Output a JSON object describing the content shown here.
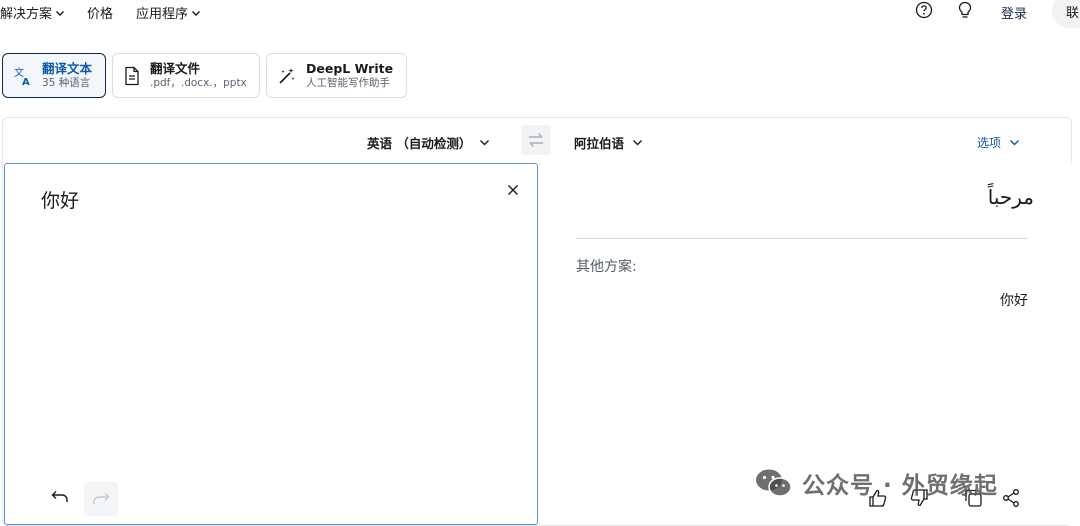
{
  "nav": {
    "solutions": "解决方案",
    "pricing": "价格",
    "apps": "应用程序",
    "login": "登录",
    "contact": "联"
  },
  "icons": {
    "help": "help-circle-icon",
    "tips": "lightbulb-icon"
  },
  "tabs": [
    {
      "title": "翻译文本",
      "subtitle": "35 种语言",
      "icon": "translate-icon",
      "active": true
    },
    {
      "title": "翻译文件",
      "subtitle": ".pdf，.docx.，pptx",
      "icon": "document-icon",
      "active": false
    },
    {
      "title": "DeepL Write",
      "subtitle": "人工智能写作助手",
      "icon": "magic-wand-icon",
      "active": false
    }
  ],
  "translator": {
    "source_lang": "英语 （自动检测）",
    "target_lang": "阿拉伯语",
    "options_label": "选项",
    "source_text": "你好",
    "target_text": "مرحباً",
    "alternatives_label": "其他方案:",
    "alternatives": [
      "你好"
    ]
  },
  "watermark": {
    "text": "公众号 · 外贸缘起"
  },
  "colors": {
    "accent_blue": "#0f5aa6",
    "active_border": "#0f2b46",
    "source_panel_border": "#5b8fd0"
  }
}
